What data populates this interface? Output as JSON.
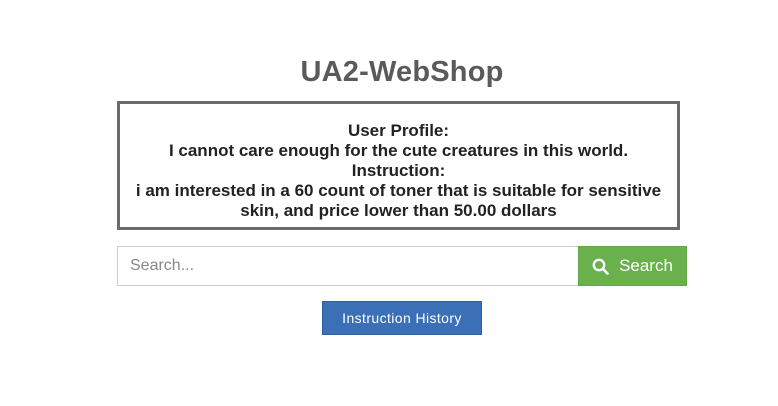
{
  "app": {
    "title": "UA2-WebShop"
  },
  "instruction_box": {
    "profile_heading": "User Profile:",
    "profile_text": "I cannot care enough for the cute creatures in this world.",
    "instruction_heading": "Instruction:",
    "instruction_line1": "i am interested in a 60 count of toner that is suitable for sensitive",
    "instruction_line2": "skin, and price lower than 50.00 dollars"
  },
  "search": {
    "placeholder": "Search...",
    "value": "",
    "button_label": "Search",
    "button_icon": "search-icon"
  },
  "history": {
    "button_label": "Instruction History"
  },
  "colors": {
    "search_button": "#6ab04c",
    "history_button": "#3b6fb6",
    "title_text": "#5a5a5a",
    "box_border": "#6b6b6b"
  }
}
